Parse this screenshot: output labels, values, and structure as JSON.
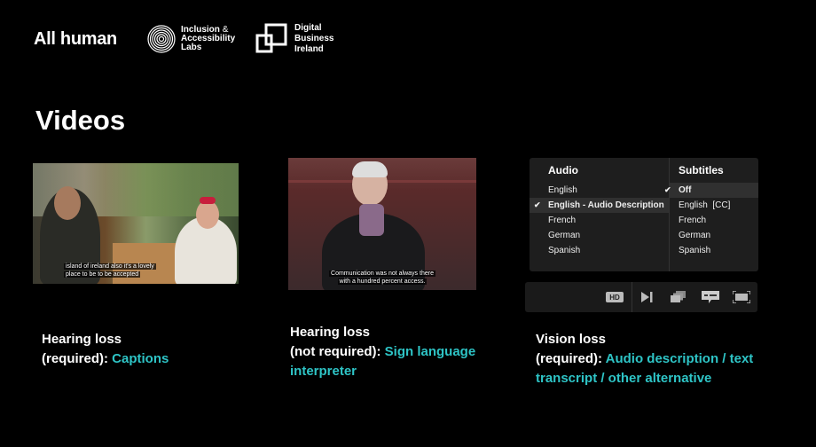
{
  "logos": {
    "all_human": "All human",
    "inclusion_lines": [
      "Inclusion",
      "Accessibility",
      "Labs"
    ],
    "inclusion_amp": "&",
    "digital_lines": [
      "Digital",
      "Business",
      "Ireland"
    ]
  },
  "page_title": "Videos",
  "videos": [
    {
      "caption_lines": [
        "island of ireland also it's a lovely",
        "place to be to be accepted"
      ]
    },
    {
      "caption_lines": [
        "Communication was not always there",
        "with a hundred percent access."
      ]
    }
  ],
  "player_menu": {
    "audio": {
      "heading": "Audio",
      "items": [
        "English",
        "English - Audio Description",
        "French",
        "German",
        "Spanish"
      ],
      "selected": "English - Audio Description"
    },
    "subtitles": {
      "heading": "Subtitles",
      "items": [
        "Off",
        "English  [CC]",
        "French",
        "German",
        "Spanish"
      ],
      "selected": "Off"
    },
    "check_glyph": "✔",
    "controls": {
      "hd_label": "HD",
      "icons": [
        "hd-icon",
        "next-icon",
        "playlist-icon",
        "subtitles-icon",
        "fullscreen-icon"
      ]
    }
  },
  "descriptions": [
    {
      "line1": "Hearing loss",
      "prefix": "(required): ",
      "accent": "Captions"
    },
    {
      "line1": "Hearing loss",
      "prefix": "(not required): ",
      "accent": "Sign language interpreter"
    },
    {
      "line1": "Vision loss",
      "prefix": "(required): ",
      "accent": "Audio description / text transcript / other alternative"
    }
  ],
  "colors": {
    "accent": "#2ec4c6",
    "background": "#000000"
  }
}
